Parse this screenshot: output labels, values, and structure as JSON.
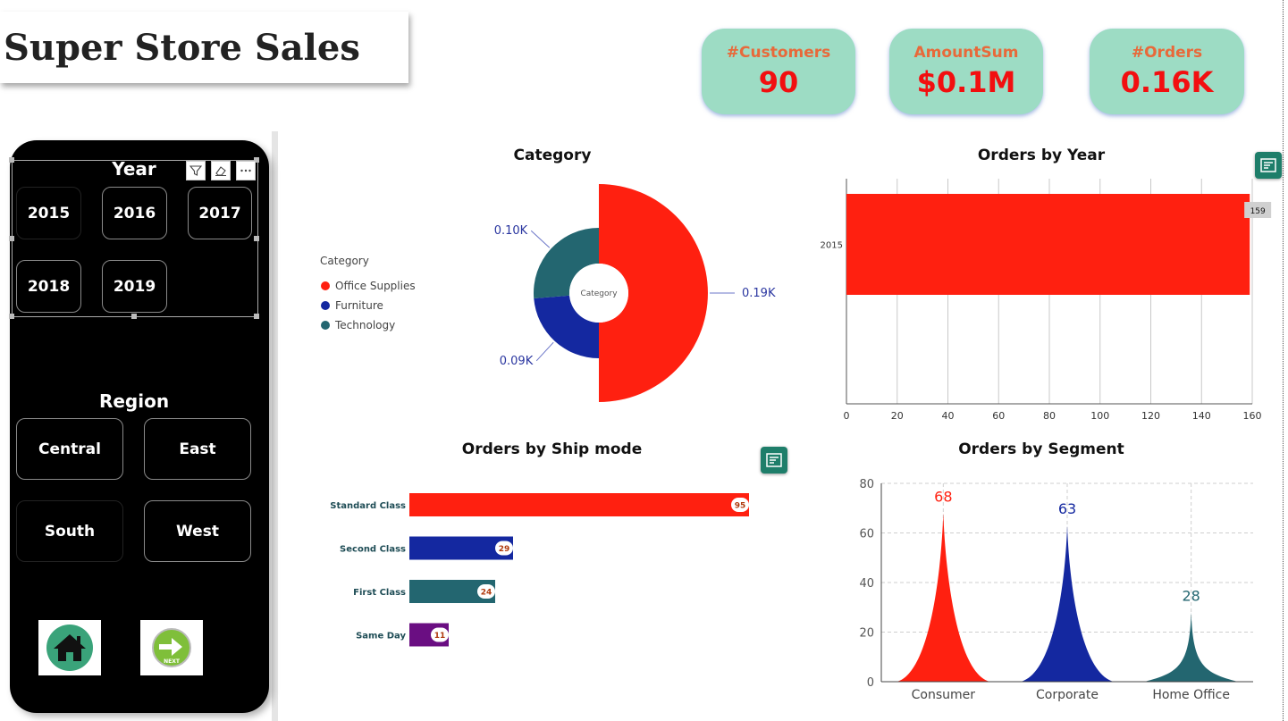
{
  "header": {
    "title": "Super Store Sales"
  },
  "kpis": [
    {
      "label": "#Customers",
      "value": "90"
    },
    {
      "label": "AmountSum",
      "value": "$0.1M"
    },
    {
      "label": "#Orders",
      "value": "0.16K"
    }
  ],
  "year_slicer": {
    "title": "Year",
    "options": [
      "2015",
      "2016",
      "2017",
      "2018",
      "2019"
    ]
  },
  "region_slicer": {
    "title": "Region",
    "options": [
      "Central",
      "East",
      "South",
      "West"
    ]
  },
  "nav": {
    "home_icon": "home-icon",
    "next_icon": "next-arrow-icon",
    "next_text": "NEXT"
  },
  "colors": {
    "red": "#ff2010",
    "navy": "#1428a0",
    "teal": "#236670",
    "purple": "#6a0e82",
    "kpi_bg": "#9ddcc4"
  },
  "chart_data": [
    {
      "type": "pie",
      "title": "Category",
      "legend_title": "Category",
      "center_label": "Category",
      "legend": "left",
      "slices": [
        {
          "name": "Office Supplies",
          "value": 190,
          "label": "0.19K"
        },
        {
          "name": "Furniture",
          "value": 90,
          "label": "0.09K"
        },
        {
          "name": "Technology",
          "value": 100,
          "label": "0.10K"
        }
      ]
    },
    {
      "type": "bar",
      "orientation": "horizontal",
      "title": "Orders by Year",
      "categories": [
        "2015"
      ],
      "values": [
        159
      ],
      "xlim": [
        0,
        160
      ],
      "xticks": [
        0,
        20,
        40,
        60,
        80,
        100,
        120,
        140,
        160
      ],
      "grid": true
    },
    {
      "type": "bar",
      "orientation": "horizontal",
      "title": "Orders by Ship mode",
      "categories": [
        "Standard Class",
        "Second Class",
        "First Class",
        "Same Day"
      ],
      "values": [
        95,
        29,
        24,
        11
      ]
    },
    {
      "type": "area",
      "title": "Orders by Segment",
      "categories": [
        "Consumer",
        "Corporate",
        "Home Office"
      ],
      "values": [
        68,
        63,
        28
      ],
      "ylim": [
        0,
        80
      ],
      "yticks": [
        0,
        20,
        40,
        60,
        80
      ],
      "grid": true
    }
  ]
}
